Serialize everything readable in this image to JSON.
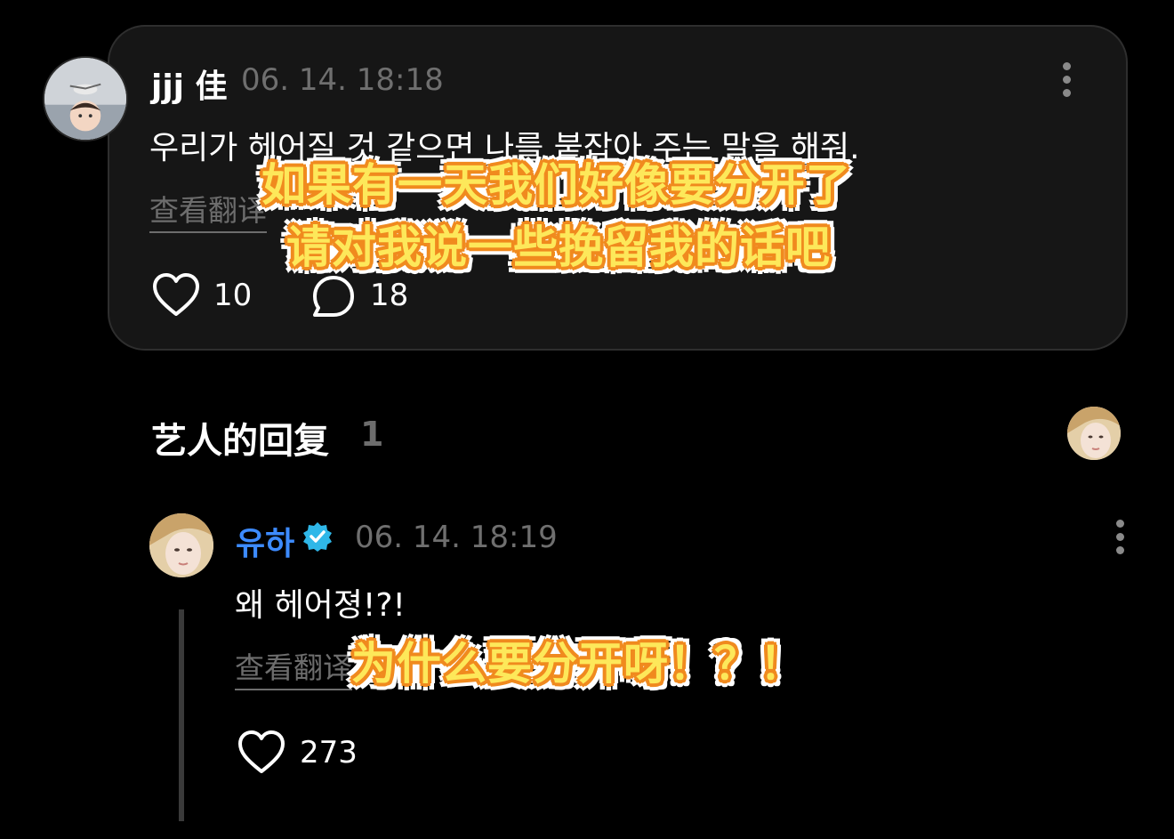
{
  "post": {
    "username": "jjj 佳",
    "timestamp": "06. 14. 18:18",
    "text": "우리가 헤어질 것 같으면 나를 붙잡아 주는 말을 해줘.",
    "translate_label": "查看翻译",
    "likes": "10",
    "comments": "18",
    "caption_line1": "如果有一天我们好像要分开了",
    "caption_line2": "请对我说一些挽留我的话吧"
  },
  "replies_section": {
    "title": "艺人的回复",
    "count": "1"
  },
  "reply": {
    "username": "유하",
    "timestamp": "06. 14. 18:19",
    "text": "왜 헤어졍!?!",
    "translate_label": "查看翻译",
    "likes": "273",
    "caption": "为什么要分开呀！？！"
  },
  "colors": {
    "background": "#000000",
    "card": "#161616",
    "artist_name": "#3d8bff",
    "verified_badge": "#2fb7e8",
    "caption_fill": "#fde85a",
    "caption_outline": "#f08a1e"
  },
  "icons": [
    "more-vertical-icon",
    "heart-icon",
    "comment-bubble-icon",
    "verified-badge-icon"
  ]
}
